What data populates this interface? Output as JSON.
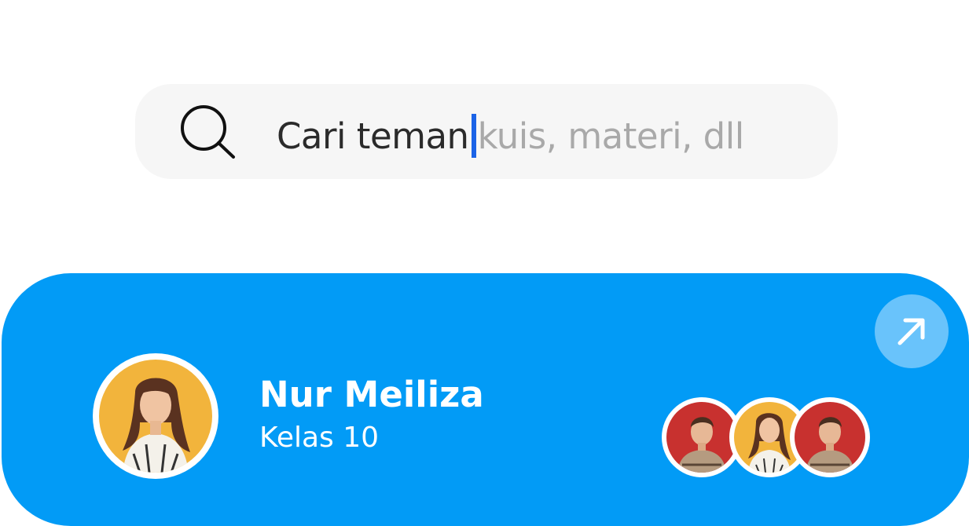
{
  "search": {
    "typed_text": "Cari teman",
    "placeholder_suffix": "kuis, materi, dll",
    "icon": "search-icon"
  },
  "profile": {
    "name": "Nur Meiliza",
    "class_label": "Kelas 10",
    "avatar": "female-student-avatar",
    "avatar_bg": "#f2b43c"
  },
  "friends": [
    {
      "avatar": "male-student-avatar",
      "bg": "#c8312f"
    },
    {
      "avatar": "female-student-avatar",
      "bg": "#f2b43c"
    },
    {
      "avatar": "male-student-avatar",
      "bg": "#c8312f"
    }
  ],
  "open_button": {
    "icon": "arrow-up-right-icon"
  },
  "colors": {
    "card": "#029bf6",
    "caret": "#1b63e7",
    "search_bg": "#f6f6f6"
  }
}
